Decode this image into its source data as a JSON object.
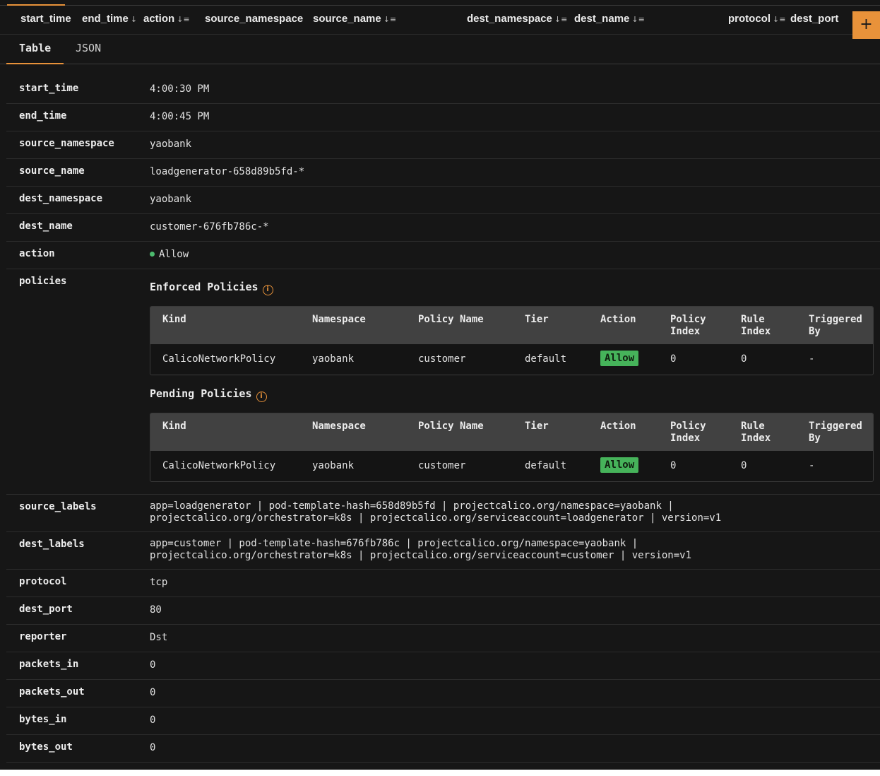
{
  "column_headers": [
    {
      "label": "start_time",
      "sort": ""
    },
    {
      "label": "end_time",
      "sort": "↓"
    },
    {
      "label": "action",
      "sort": "↓≡"
    },
    {
      "label": "source_namespace",
      "sort": ""
    },
    {
      "label": "source_name",
      "sort": "↓≡"
    },
    {
      "label": "dest_namespace",
      "sort": "↓≡"
    },
    {
      "label": "dest_name",
      "sort": "↓≡"
    },
    {
      "label": "protocol",
      "sort": "↓≡"
    },
    {
      "label": "dest_port",
      "sort": ""
    }
  ],
  "add_button_label": "+",
  "tabs": [
    {
      "label": "Table",
      "active": true
    },
    {
      "label": "JSON",
      "active": false
    }
  ],
  "fields": {
    "start_time": {
      "key": "start_time",
      "value": "4:00:30 PM"
    },
    "end_time": {
      "key": "end_time",
      "value": "4:00:45 PM"
    },
    "source_namespace": {
      "key": "source_namespace",
      "value": "yaobank"
    },
    "source_name": {
      "key": "source_name",
      "value": "loadgenerator-658d89b5fd-*"
    },
    "dest_namespace": {
      "key": "dest_namespace",
      "value": "yaobank"
    },
    "dest_name": {
      "key": "dest_name",
      "value": "customer-676fb786c-*"
    },
    "action": {
      "key": "action",
      "value": "Allow",
      "status_color": "#4cbb6e"
    },
    "policies": {
      "key": "policies"
    },
    "source_labels": {
      "key": "source_labels",
      "line1": "app=loadgenerator | pod-template-hash=658d89b5fd | projectcalico.org/namespace=yaobank |",
      "line2": "projectcalico.org/orchestrator=k8s | projectcalico.org/serviceaccount=loadgenerator | version=v1"
    },
    "dest_labels": {
      "key": "dest_labels",
      "line1": "app=customer | pod-template-hash=676fb786c | projectcalico.org/namespace=yaobank |",
      "line2": "projectcalico.org/orchestrator=k8s | projectcalico.org/serviceaccount=customer | version=v1"
    },
    "protocol": {
      "key": "protocol",
      "value": "tcp"
    },
    "dest_port": {
      "key": "dest_port",
      "value": "80"
    },
    "reporter": {
      "key": "reporter",
      "value": "Dst"
    },
    "packets_in": {
      "key": "packets_in",
      "value": "0"
    },
    "packets_out": {
      "key": "packets_out",
      "value": "0"
    },
    "bytes_in": {
      "key": "bytes_in",
      "value": "0"
    },
    "bytes_out": {
      "key": "bytes_out",
      "value": "0"
    }
  },
  "policy_columns": {
    "kind": "Kind",
    "namespace": "Namespace",
    "policy_name": "Policy Name",
    "tier": "Tier",
    "action": "Action",
    "policy_index_1": "Policy",
    "policy_index_2": "Index",
    "rule_index_1": "Rule",
    "rule_index_2": "Index",
    "triggered_by_1": "Triggered",
    "triggered_by_2": "By"
  },
  "enforced_policies": {
    "title": "Enforced Policies",
    "info_icon": "info-icon",
    "row": {
      "kind": "CalicoNetworkPolicy",
      "namespace": "yaobank",
      "policy_name": "customer",
      "tier": "default",
      "action": "Allow",
      "policy_index": "0",
      "rule_index": "0",
      "triggered_by": "-"
    }
  },
  "pending_policies": {
    "title": "Pending Policies",
    "info_icon": "info-icon",
    "row": {
      "kind": "CalicoNetworkPolicy",
      "namespace": "yaobank",
      "policy_name": "customer",
      "tier": "default",
      "action": "Allow",
      "policy_index": "0",
      "rule_index": "0",
      "triggered_by": "-"
    }
  },
  "colors": {
    "accent": "#e8923a",
    "background": "#161616",
    "allow_badge": "#46b35a",
    "table_header": "#414141"
  }
}
